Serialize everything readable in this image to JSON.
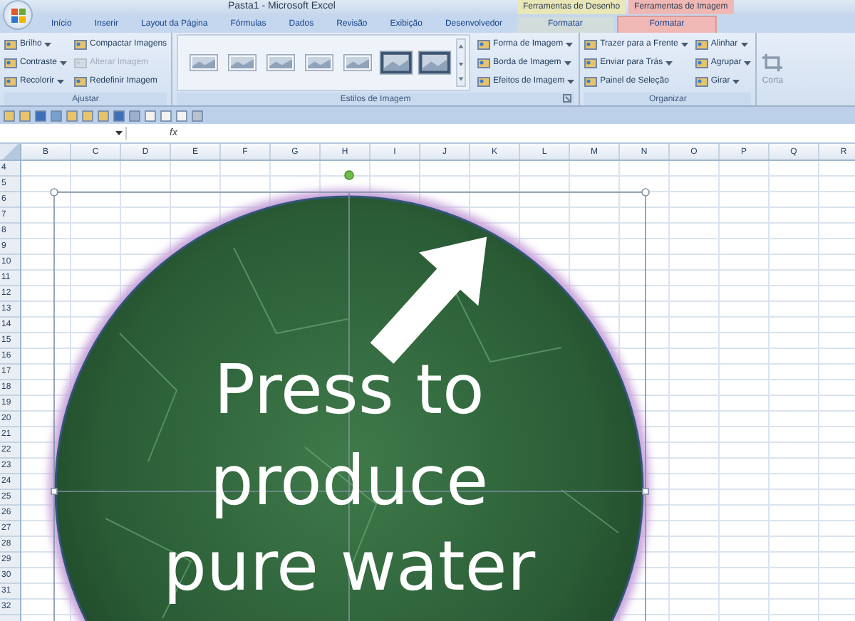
{
  "window": {
    "title": "Pasta1 - Microsoft Excel"
  },
  "tabs": [
    {
      "label": "Início",
      "selected": false
    },
    {
      "label": "Inserir",
      "selected": false
    },
    {
      "label": "Layout da Página",
      "selected": false
    },
    {
      "label": "Fórmulas",
      "selected": false
    },
    {
      "label": "Dados",
      "selected": false
    },
    {
      "label": "Revisão",
      "selected": false
    },
    {
      "label": "Exibição",
      "selected": false
    },
    {
      "label": "Desenvolvedor",
      "selected": false
    }
  ],
  "context_tabs": [
    {
      "label": "Ferramentas de Desenho",
      "color": "#e9e6b8",
      "tabs": [
        {
          "label": "Formatar",
          "selected": false
        }
      ]
    },
    {
      "label": "Ferramentas de Imagem",
      "color": "#f0b8b4",
      "tabs": [
        {
          "label": "Formatar",
          "selected": true
        }
      ]
    }
  ],
  "ribbon": {
    "groups": [
      {
        "label": "Ajustar",
        "kind": "commands",
        "columns": [
          [
            {
              "label": "Brilho",
              "dropdown": true,
              "disabled": false
            },
            {
              "label": "Contraste",
              "dropdown": true,
              "disabled": false
            },
            {
              "label": "Recolorir",
              "dropdown": true,
              "disabled": false
            }
          ],
          [
            {
              "label": "Compactar Imagens",
              "dropdown": false,
              "disabled": false
            },
            {
              "label": "Alterar Imagem",
              "dropdown": false,
              "disabled": true
            },
            {
              "label": "Redefinir Imagem",
              "dropdown": false,
              "disabled": false
            }
          ]
        ]
      },
      {
        "label": "Estilos de Imagem",
        "kind": "gallery",
        "columns": [
          [
            {
              "label": "Forma de Imagem",
              "dropdown": true,
              "disabled": false
            },
            {
              "label": "Borda de Imagem",
              "dropdown": true,
              "disabled": false
            },
            {
              "label": "Efeitos de Imagem",
              "dropdown": true,
              "disabled": false
            }
          ]
        ]
      },
      {
        "label": "Organizar",
        "kind": "commands",
        "columns": [
          [
            {
              "label": "Trazer para a Frente",
              "dropdown": true,
              "disabled": false
            },
            {
              "label": "Enviar para Trás",
              "dropdown": true,
              "disabled": false
            },
            {
              "label": "Painel de Seleção",
              "dropdown": false,
              "disabled": false
            }
          ],
          [
            {
              "label": "Alinhar",
              "dropdown": true,
              "disabled": false
            },
            {
              "label": "Agrupar",
              "dropdown": true,
              "disabled": false
            },
            {
              "label": "Girar",
              "dropdown": true,
              "disabled": false
            }
          ]
        ]
      },
      {
        "kind": "partial",
        "big_button": "Corta"
      }
    ]
  },
  "formula_bar": {
    "function_symbol": "fx"
  },
  "sheet": {
    "columns": [
      "B",
      "C",
      "D",
      "E",
      "F",
      "G",
      "H",
      "I",
      "J",
      "K",
      "L",
      "M",
      "N",
      "O",
      "P",
      "Q",
      "R"
    ],
    "rows": [
      "4",
      "5",
      "6",
      "7",
      "8",
      "9",
      "10",
      "11",
      "12",
      "13",
      "14",
      "15",
      "16",
      "17",
      "18",
      "19",
      "20",
      "21",
      "22",
      "23",
      "24",
      "25",
      "26",
      "27",
      "28",
      "29",
      "30",
      "31",
      "32"
    ]
  },
  "shape": {
    "text_lines": [
      "Press to",
      "produce",
      "pure water"
    ]
  }
}
